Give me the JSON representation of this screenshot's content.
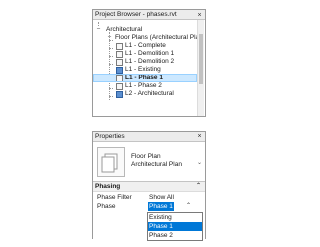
{
  "project_browser": {
    "title": "Project Browser - phases.rvt",
    "close_glyph": "×",
    "tree": [
      {
        "label": "Architectural",
        "expander": "−",
        "icon": "none"
      },
      {
        "label": "Floor Plans (Architectural Pla",
        "expander": "−",
        "icon": "none"
      },
      {
        "label": "L1 - Complete",
        "icon": "view-plain"
      },
      {
        "label": "L1 - Demolition 1",
        "icon": "view-plain"
      },
      {
        "label": "L1 - Demolition 2",
        "icon": "view-plain"
      },
      {
        "label": "L1 - Existing",
        "icon": "view-blue"
      },
      {
        "label": "L1 - Phase 1",
        "icon": "view-plain",
        "selected": true
      },
      {
        "label": "L1 - Phase 2",
        "icon": "view-plain"
      },
      {
        "label": "L2 - Architectural",
        "icon": "view-blue"
      }
    ]
  },
  "properties": {
    "title": "Properties",
    "close_glyph": "×",
    "type_selector": {
      "line1": "Floor Plan",
      "line2": "Architectural Plan",
      "caret": "⌄"
    },
    "section": {
      "name": "Phasing",
      "collapse_glyph": "⌃"
    },
    "rows": [
      {
        "name": "Phase Filter",
        "value": "Show All"
      },
      {
        "name": "Phase",
        "value": "Phase 1",
        "caret": "⌃"
      }
    ],
    "dropdown_options": [
      "Existing",
      "Phase 1",
      "Phase 2"
    ],
    "dropdown_selected": "Phase 1"
  },
  "colors": {
    "selection_blue": "#0078d7",
    "tree_selection": "#cce8ff"
  }
}
